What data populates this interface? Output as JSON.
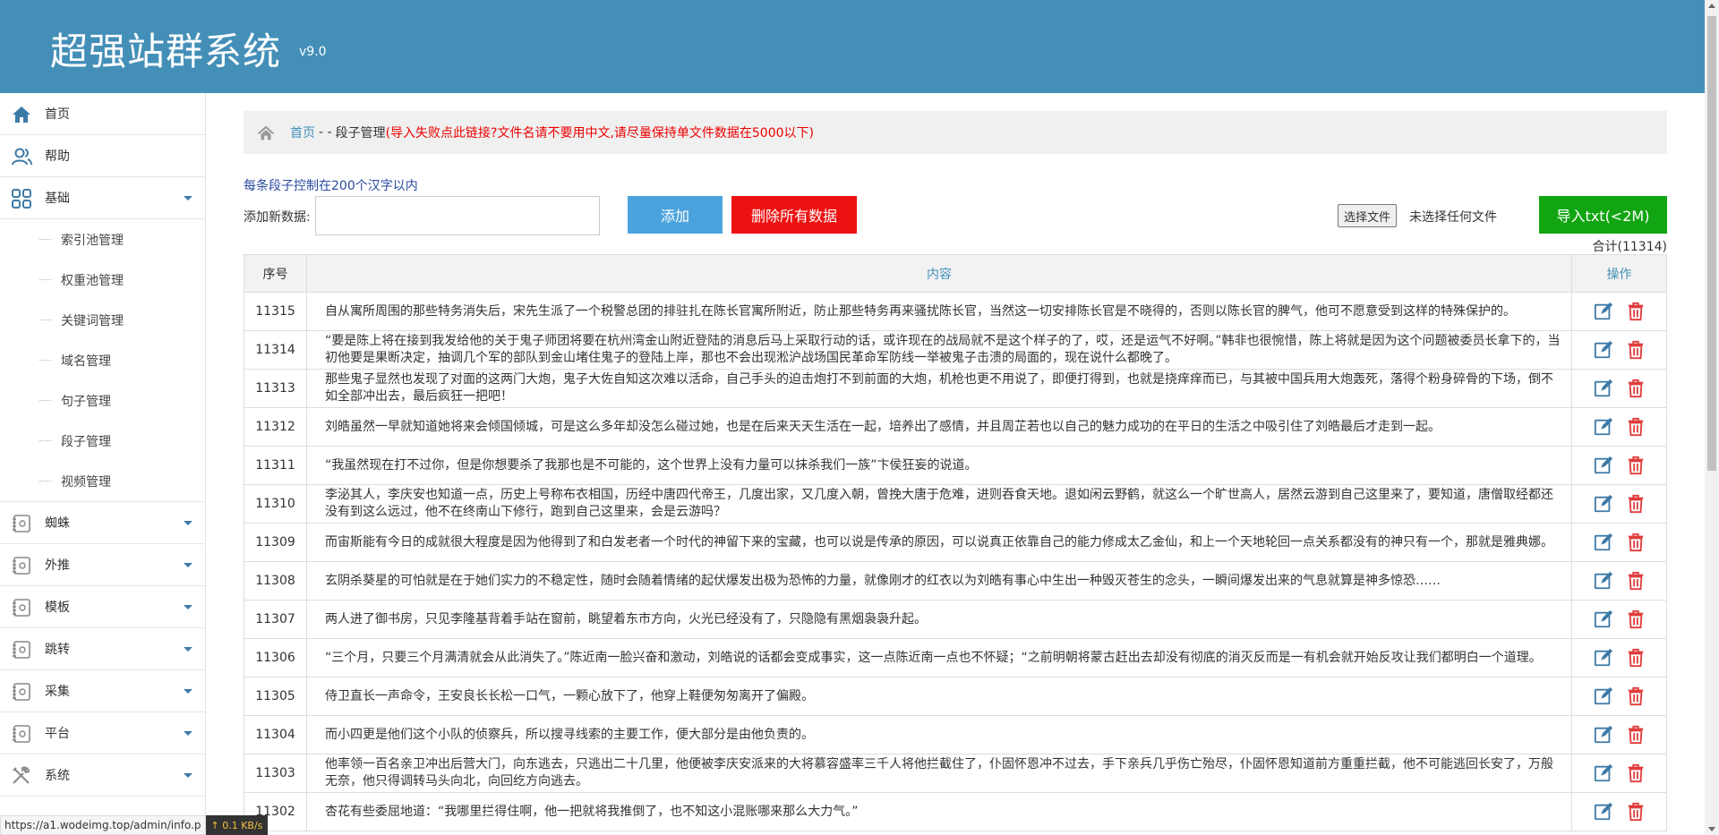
{
  "header": {
    "title": "超强站群系统",
    "version": "v9.0"
  },
  "sidebar": {
    "items": [
      {
        "label": "首页",
        "icon": "home-icon",
        "expandable": false
      },
      {
        "label": "帮助",
        "icon": "user-icon",
        "expandable": false
      },
      {
        "label": "基础",
        "icon": "grid-icon",
        "expandable": true,
        "expanded": true,
        "children": [
          "索引池管理",
          "权重池管理",
          "关键词管理",
          "域名管理",
          "句子管理",
          "段子管理",
          "视频管理"
        ]
      },
      {
        "label": "蜘蛛",
        "icon": "notebook-icon",
        "expandable": true
      },
      {
        "label": "外推",
        "icon": "notebook-icon",
        "expandable": true
      },
      {
        "label": "模板",
        "icon": "notebook-icon",
        "expandable": true
      },
      {
        "label": "跳转",
        "icon": "notebook-icon",
        "expandable": true
      },
      {
        "label": "采集",
        "icon": "notebook-icon",
        "expandable": true
      },
      {
        "label": "平台",
        "icon": "notebook-icon",
        "expandable": true
      },
      {
        "label": "系统",
        "icon": "tools-icon",
        "expandable": true
      }
    ]
  },
  "breadcrumb": {
    "home": "首页",
    "separator": "- -",
    "current": "段子管理",
    "warning": "(导入失败点此链接?文件名请不要用中文,请尽量保持单文件数据在5000以下)"
  },
  "form": {
    "hint": "每条段子控制在200个汉字以内",
    "add_label": "添加新数据:",
    "add_value": "",
    "add_button": "添加",
    "delete_all_button": "删除所有数据",
    "file_button": "选择文件",
    "file_status": "未选择任何文件",
    "import_button": "导入txt(<2M)",
    "total": "合计(11314)"
  },
  "table": {
    "headers": {
      "id": "序号",
      "content": "内容",
      "op": "操作"
    },
    "rows": [
      {
        "id": "11315",
        "content": "自从寓所周围的那些特务消失后，宋先生派了一个税警总团的排驻扎在陈长官寓所附近，防止那些特务再来骚扰陈长官，当然这一切安排陈长官是不晓得的，否则以陈长官的脾气，他可不愿意受到这样的特殊保护的。"
      },
      {
        "id": "11314",
        "content": "“要是陈上将在接到我发给他的关于鬼子师团将要在杭州湾金山附近登陆的消息后马上采取行动的话，或许现在的战局就不是这个样子的了，哎，还是运气不好啊。”韩非也很惋惜，陈上将就是因为这个问题被委员长拿下的，当初他要是果断决定，抽调几个军的部队到金山堵住鬼子的登陆上岸，那也不会出现淞沪战场国民革命军防线一举被鬼子击溃的局面的，现在说什么都晚了。"
      },
      {
        "id": "11313",
        "content": "那些鬼子显然也发现了对面的这两门大炮，鬼子大佐自知这次难以活命，自己手头的迫击炮打不到前面的大炮，机枪也更不用说了，即便打得到，也就是挠痒痒而已，与其被中国兵用大炮轰死，落得个粉身碎骨的下场，倒不如全部冲出去，最后疯狂一把吧！"
      },
      {
        "id": "11312",
        "content": "刘皓虽然一早就知道她将来会倾国倾城，可是这么多年却没怎么碰过她，也是在后来天天生活在一起，培养出了感情，并且周芷若也以自己的魅力成功的在平日的生活之中吸引住了刘皓最后才走到一起。"
      },
      {
        "id": "11311",
        "content": "“我虽然现在打不过你，但是你想要杀了我那也是不可能的，这个世界上没有力量可以抹杀我们一族”卞侯狂妄的说道。"
      },
      {
        "id": "11310",
        "content": "李泌其人，李庆安也知道一点，历史上号称布衣相国，历经中唐四代帝王，几度出家，又几度入朝，曾挽大唐于危难，进则吞食天地。退如闲云野鹤，就这么一个旷世高人，居然云游到自己这里来了，要知道，唐僧取经都还没有到这么远过，他不在终南山下修行，跑到自己这里来，会是云游吗？"
      },
      {
        "id": "11309",
        "content": "而宙斯能有今日的成就很大程度是因为他得到了和白发老者一个时代的神留下来的宝藏，也可以说是传承的原因，可以说真正依靠自己的能力修成太乙金仙，和上一个天地轮回一点关系都没有的神只有一个，那就是雅典娜。"
      },
      {
        "id": "11308",
        "content": "玄阴杀葵星的可怕就是在于她们实力的不稳定性，随时会随着情绪的起伏爆发出极为恐怖的力量，就像刚才的红衣以为刘皓有事心中生出一种毁灭苍生的念头，一瞬间爆发出来的气息就算是神多惊恐……"
      },
      {
        "id": "11307",
        "content": "两人进了御书房，只见李隆基背着手站在窗前，眺望着东市方向，火光已经没有了，只隐隐有黑烟袅袅升起。"
      },
      {
        "id": "11306",
        "content": "“三个月，只要三个月满清就会从此消失了。”陈近南一脸兴奋和激动，刘皓说的话都会变成事实，这一点陈近南一点也不怀疑；“之前明朝将蒙古赶出去却没有彻底的消灭反而是一有机会就开始反攻让我们都明白一个道理。"
      },
      {
        "id": "11305",
        "content": "侍卫直长一声命令，王安良长长松一口气，一颗心放下了，他穿上鞋便匆匆离开了偏殿。"
      },
      {
        "id": "11304",
        "content": "而小四更是他们这个小队的侦察兵，所以搜寻线索的主要工作，便大部分是由他负责的。"
      },
      {
        "id": "11303",
        "content": "他率领一百名亲卫冲出后营大门，向东逃去，只逃出二十几里，他便被李庆安派来的大将慕容盛率三千人将他拦截住了，仆固怀恩冲不过去，手下亲兵几乎伤亡殆尽，仆固怀恩知道前方重重拦截，他不可能逃回长安了，万般无奈，他只得调转马头向北，向回纥方向逃去。"
      },
      {
        "id": "11302",
        "content": "杏花有些委屈地道：“我哪里拦得住啊，他一把就将我推倒了，也不知这小混账哪来那么大力气。”"
      }
    ]
  },
  "status": {
    "url": "https://a1.wodeimg.top/admin/info.p",
    "speed": "↑ 0.1 KB/s"
  },
  "colors": {
    "header": "#448fb8",
    "accent": "#3e7aa7",
    "add": "#4ba3dd",
    "delete": "#ee1111",
    "import": "#12a512"
  }
}
